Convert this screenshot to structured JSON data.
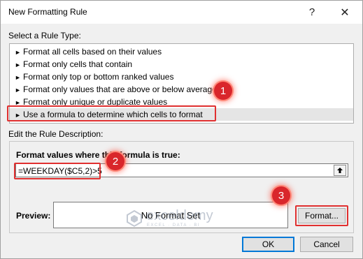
{
  "dialog": {
    "title": "New Formatting Rule",
    "help_glyph": "?",
    "close_glyph": "✕"
  },
  "rule_type": {
    "label": "Select a Rule Type:",
    "items": [
      "Format all cells based on their values",
      "Format only cells that contain",
      "Format only top or bottom ranked values",
      "Format only values that are above or below average",
      "Format only unique or duplicate values",
      "Use a formula to determine which cells to format"
    ],
    "selected_index": 5
  },
  "description": {
    "label": "Edit the Rule Description:",
    "formula_label": "Format values where this formula is true:",
    "formula_value": "=WEEKDAY($C5,2)>5"
  },
  "preview": {
    "label": "Preview:",
    "text": "No Format Set"
  },
  "buttons": {
    "format": "Format...",
    "ok": "OK",
    "cancel": "Cancel"
  },
  "annotations": {
    "badges": [
      "1",
      "2",
      "3"
    ],
    "highlight_color": "#e03030",
    "badge_color": "#d9262b"
  },
  "watermark": {
    "brand": "exceldemy",
    "tagline": "EXCEL · DATA · BI"
  }
}
